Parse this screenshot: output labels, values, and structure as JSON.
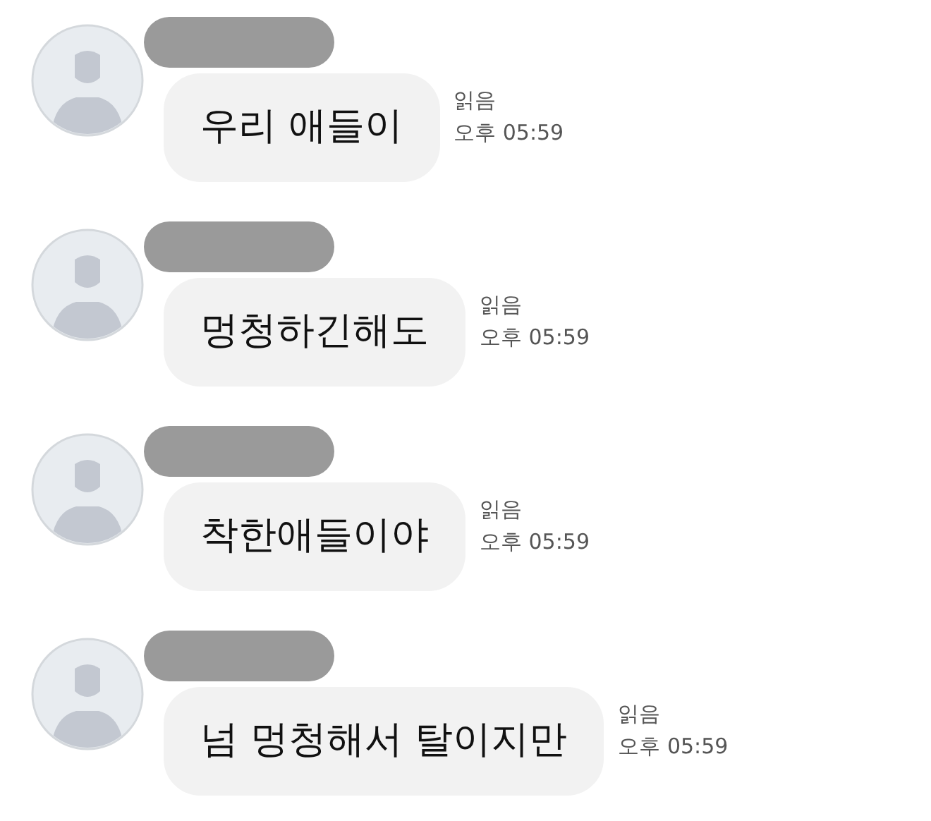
{
  "messages": [
    {
      "text": "우리 애들이",
      "read": "읽음",
      "time": "오후 05:59"
    },
    {
      "text": "멍청하긴해도",
      "read": "읽음",
      "time": "오후 05:59"
    },
    {
      "text": "착한애들이야",
      "read": "읽음",
      "time": "오후 05:59"
    },
    {
      "text": "넘 멍청해서 탈이지만",
      "read": "읽음",
      "time": "오후 05:59"
    }
  ]
}
